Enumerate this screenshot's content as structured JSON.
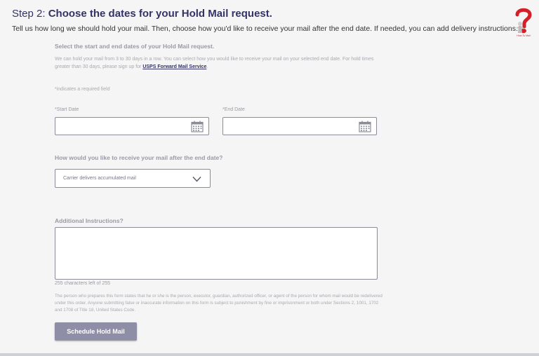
{
  "header": {
    "step_prefix": "Step 2: ",
    "step_title": "Choose the dates for your Hold Mail request.",
    "intro": "Tell us how long we should hold your mail. Then, choose how you'd like to receive your mail after the end date. If needed, you can add delivery instructions."
  },
  "logo": {
    "icon": "question-mark-figure-icon",
    "caption": "How-To Mail"
  },
  "dates_section": {
    "heading": "Select the start and end dates of your Hold Mail request.",
    "description": "We can hold your mail from 3 to 30 days in a row. You can select how you would like to receive your mail on your selected end date. For hold times greater than 30 days, please sign up for",
    "link_text": "USPS Forward Mail Service",
    "link_suffix": ".",
    "required_note": "*indicates a required field",
    "start_label": "*Start Date",
    "start_value": "",
    "end_label": "*End Date",
    "end_value": "",
    "calendar_icon": "calendar-icon"
  },
  "delivery": {
    "question": "How would you like to receive your mail after the end date?",
    "selected": "Carrier delivers accumulated mail",
    "chevron_icon": "chevron-down-icon"
  },
  "instructions": {
    "label": "Additional Instructions?",
    "value": "",
    "char_count": "255 characters left of 255"
  },
  "legal": "The person who prepares this form states that he or she is the person, executor, guardian, authorized officer, or agent of the person for whom mail would be redelivered under this order. Anyone submitting false or inaccurate information on this form is subject to punishment by fine or imprisonment or both under Sections 2, 1001, 1702 and 1708 of Title 18, United States Code.",
  "submit": {
    "label": "Schedule Hold Mail"
  },
  "colors": {
    "brand_navy": "#333366",
    "button": "#8e8ea6",
    "muted_text": "#a9a9b2",
    "logo_red": "#d32027"
  }
}
